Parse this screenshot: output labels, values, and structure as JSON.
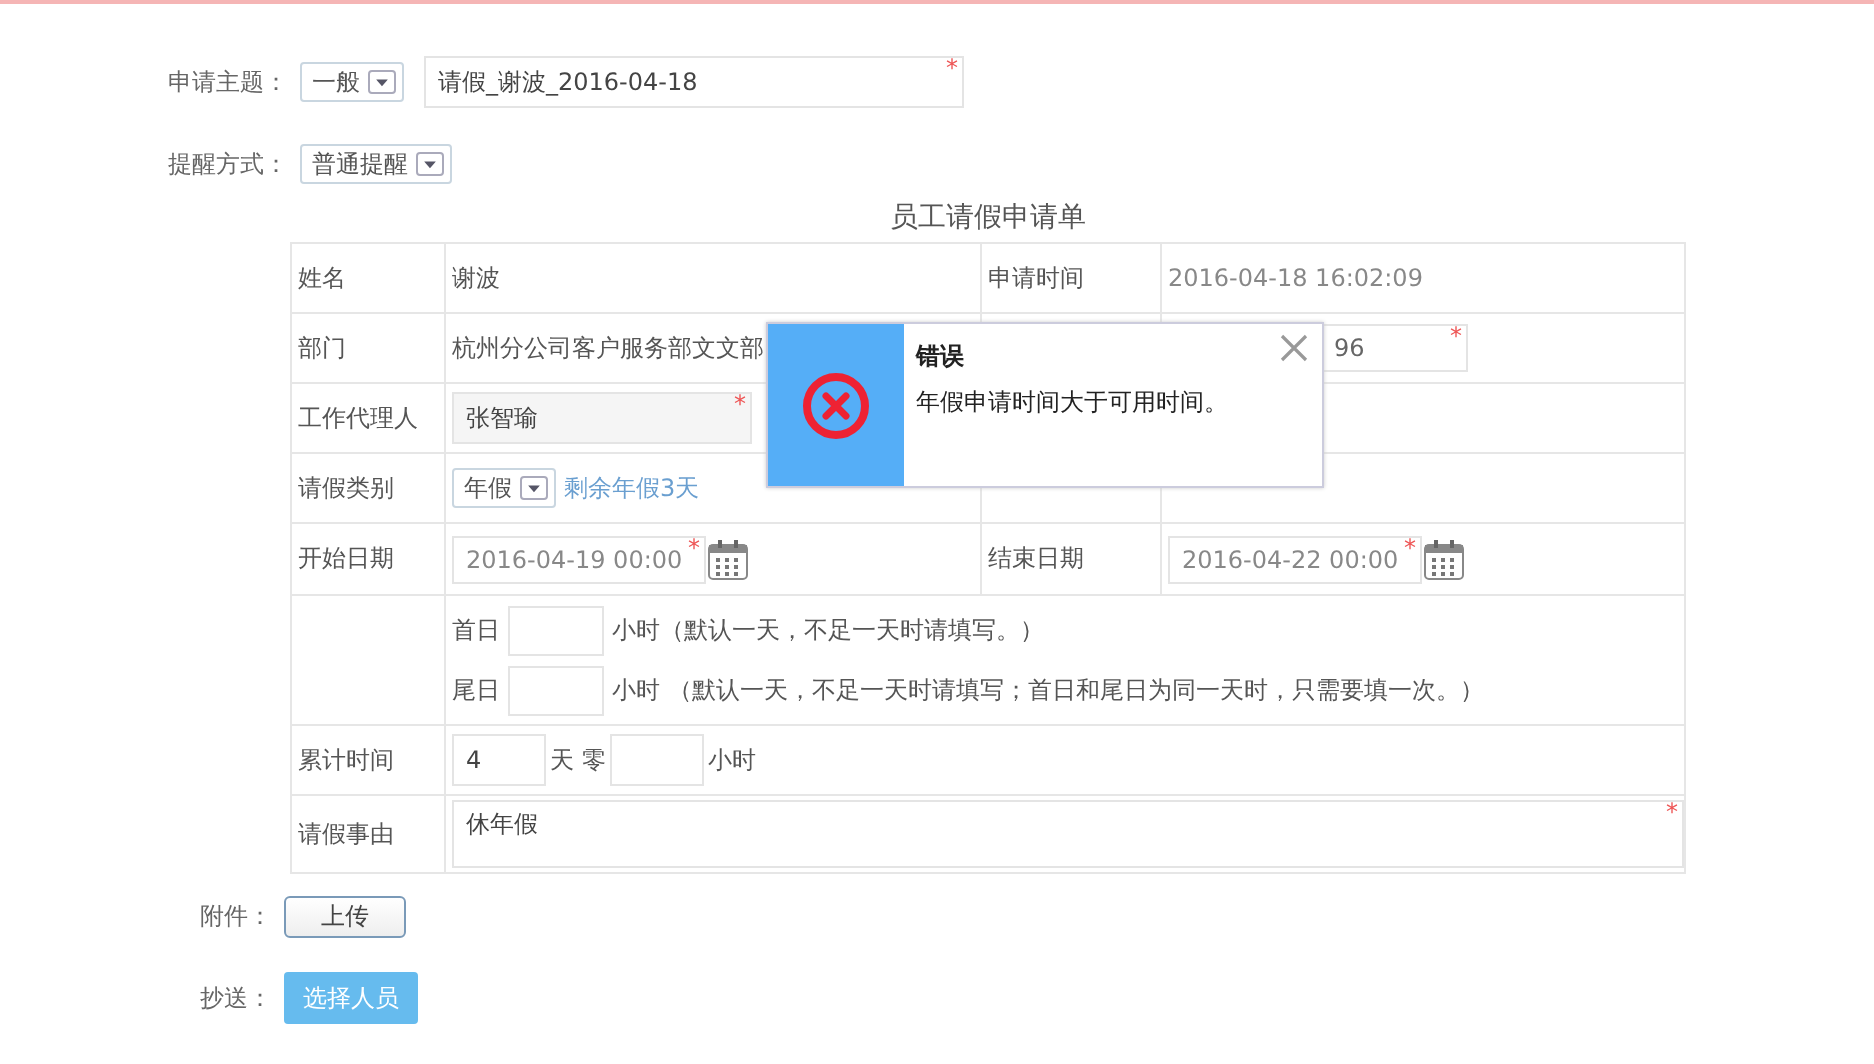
{
  "subject": {
    "label": "申请主题：",
    "category": "一般",
    "value": "请假_谢波_2016-04-18",
    "required_mark": "*"
  },
  "reminder": {
    "label": "提醒方式：",
    "value": "普通提醒"
  },
  "form": {
    "title": "员工请假申请单",
    "name_label": "姓名",
    "name": "谢波",
    "time_label": "申请时间",
    "time": "2016-04-18 16:02:09",
    "dept_label": "部门",
    "dept": "杭州分公司客户服务部文文部",
    "phone": {
      "value": "96",
      "required_mark": "*"
    },
    "agent_label": "工作代理人",
    "agent": {
      "value": "张智瑜",
      "required_mark": "*"
    },
    "type_label": "请假类别",
    "type": "年假",
    "remaining": "剩余年假3天",
    "start_label": "开始日期",
    "start": {
      "value": "2016-04-19 00:00",
      "required_mark": "*"
    },
    "end_label": "结束日期",
    "end": {
      "value": "2016-04-22 00:00",
      "required_mark": "*"
    },
    "first_day_label": "首日",
    "first_day_note": "小时（默认一天，不足一天时请填写。）",
    "last_day_label": "尾日",
    "last_day_note": "小时 （默认一天，不足一天时请填写；首日和尾日为同一天时，只需要填一次。）",
    "total_label": "累计时间",
    "total_days": "4",
    "days_unit": "天 零",
    "hours_unit": "小时",
    "reason_label": "请假事由",
    "reason": {
      "value": "休年假",
      "required_mark": "*"
    }
  },
  "attachment": {
    "label": "附件：",
    "button": "上传"
  },
  "cc": {
    "label": "抄送：",
    "button": "选择人员"
  },
  "dialog": {
    "title": "错误",
    "message": "年假申请时间大于可用时间。"
  }
}
